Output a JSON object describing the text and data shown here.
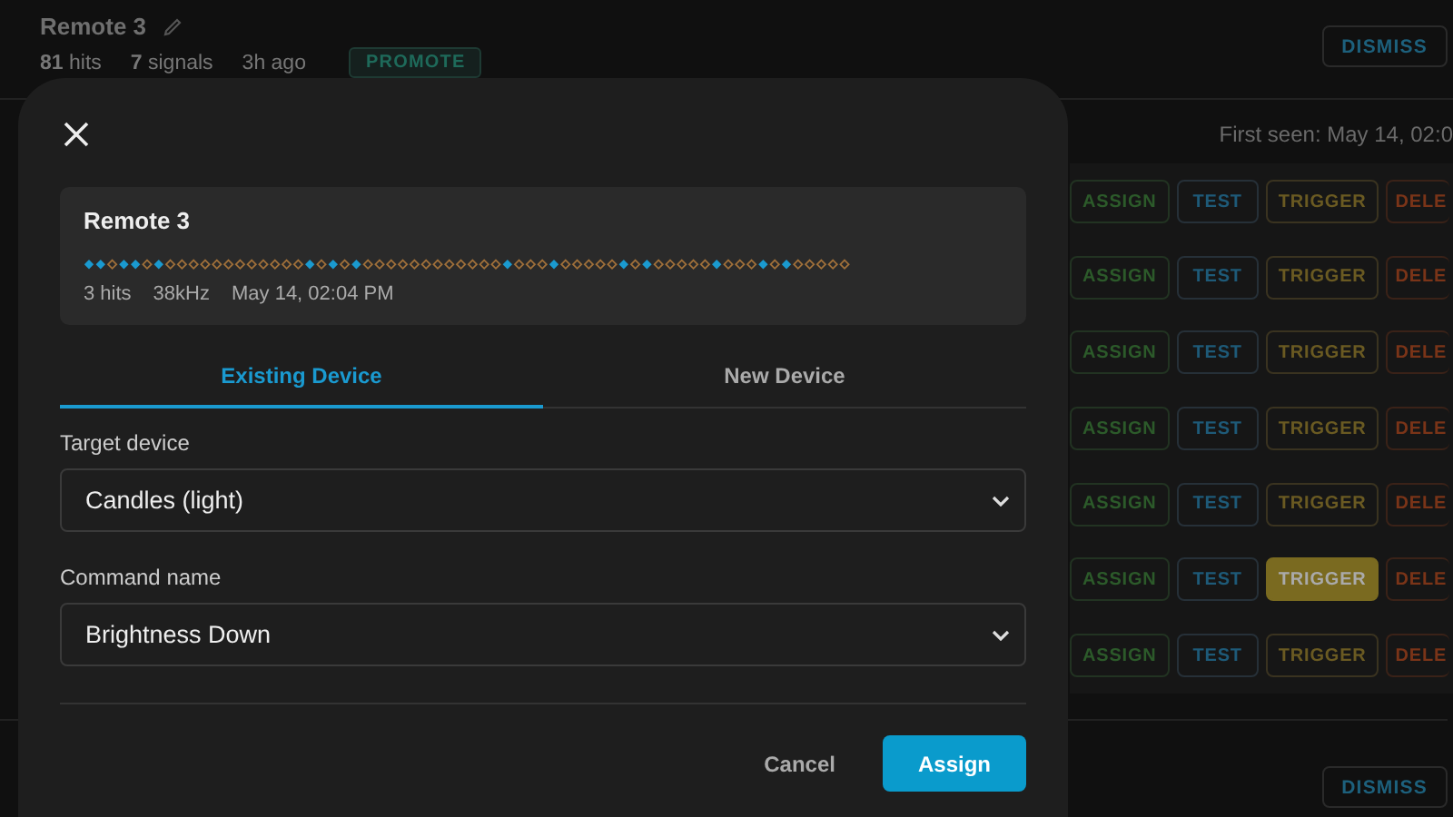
{
  "background": {
    "header": {
      "title": "Remote 3",
      "stats": [
        "**81** hits",
        "**7** signals"
      ],
      "age": "3h ago",
      "badge": "PROMOTE",
      "dismiss": "DISMISS"
    },
    "first_seen": "First seen: May 14, 02:0",
    "rows": [
      {
        "assign": "ASSIGN",
        "test": "TEST",
        "trigger": "TRIGGER",
        "trigger_active": false,
        "delete": "DELE"
      },
      {
        "assign": "ASSIGN",
        "test": "TEST",
        "trigger": "TRIGGER",
        "trigger_active": false,
        "delete": "DELE"
      },
      {
        "assign": "ASSIGN",
        "test": "TEST",
        "trigger": "TRIGGER",
        "trigger_active": false,
        "delete": "DELE"
      },
      {
        "assign": "ASSIGN",
        "test": "TEST",
        "trigger": "TRIGGER",
        "trigger_active": false,
        "delete": "DELE"
      },
      {
        "assign": "ASSIGN",
        "test": "TEST",
        "trigger": "TRIGGER",
        "trigger_active": false,
        "delete": "DELE"
      },
      {
        "assign": "ASSIGN",
        "test": "TEST",
        "trigger": "TRIGGER",
        "trigger_active": true,
        "delete": "DELE"
      },
      {
        "assign": "ASSIGN",
        "test": "TEST",
        "trigger": "TRIGGER",
        "trigger_active": false,
        "delete": "DELE"
      }
    ],
    "footer_dismiss": "DISMISS"
  },
  "dialog": {
    "signal": {
      "name": "Remote 3",
      "hits": "3 hits",
      "frequency": "38kHz",
      "time": "May 14, 02:04 PM"
    },
    "tabs": [
      {
        "label": "Existing Device",
        "selected": true
      },
      {
        "label": "New Device",
        "selected": false
      }
    ],
    "fields": [
      {
        "label": "Target device",
        "value": "Candles (light)"
      },
      {
        "label": "Command name",
        "value": "Brightness Down"
      }
    ],
    "buttons": [
      {
        "label": "Cancel",
        "kind": "text"
      },
      {
        "label": "Assign",
        "kind": "primary"
      }
    ]
  }
}
